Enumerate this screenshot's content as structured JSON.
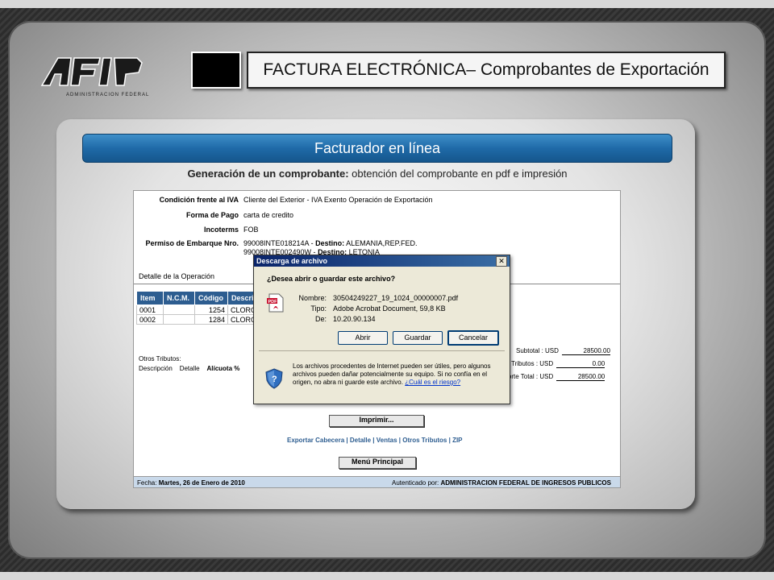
{
  "slide": {
    "logo_text": "AFIP",
    "logo_subtext": "ADMINISTRACION FEDERAL",
    "title": "FACTURA ELECTRÓNICA– Comprobantes de Exportación",
    "banner": "Facturador en línea",
    "subtitle_bold": "Generación de un comprobante:",
    "subtitle_rest": " obtención del comprobante  en pdf e impresión"
  },
  "form": {
    "fields": [
      {
        "label": "Condición frente al IVA",
        "value": "Cliente del Exterior - IVA Exento Operación de Exportación"
      },
      {
        "label": "Forma de Pago",
        "value": "carta de credito"
      },
      {
        "label": "Incoterms",
        "value": "FOB"
      },
      {
        "label": "Permiso de Embarque Nro.",
        "value": "99008INTE018214A - ",
        "dest_label": "Destino:",
        "dest": " ALEMANIA,REP.FED."
      }
    ],
    "permiso2": "99008INTE002490W - ",
    "permiso2_dest_label": "Destino:",
    "permiso2_dest": " LETONIA",
    "detalle_title": "Detalle de la Operación",
    "table": {
      "headers": [
        "Item",
        "N.C.M.",
        "Código",
        "Descrip"
      ],
      "rows": [
        [
          "0001",
          "",
          "1254",
          "CLORO"
        ],
        [
          "0002",
          "",
          "1284",
          "CLORO"
        ]
      ]
    },
    "subtotal_label": "Subtotal : USD",
    "subtotal_value": "28500.00",
    "tributos_label": "Tributos : USD",
    "tributos_value": "0.00",
    "total_label": "nporte Total : USD",
    "total_value": "28500.00",
    "otros_title": "Otros Tributos:",
    "otros_headers": [
      "Descripción",
      "Detalle",
      "Alícuota %"
    ],
    "imprimir": "Imprimir...",
    "links": [
      "Exportar Cabecera",
      "Detalle",
      "Ventas",
      "Otros Tributos",
      "ZIP"
    ],
    "link_sep": " | ",
    "menu_principal": "Menú Principal",
    "footer_fecha_label": "Fecha: ",
    "footer_fecha": "Martes, 26 de Enero de 2010",
    "footer_auth_label": "Autenticado por: ",
    "footer_auth": "ADMINISTRACION FEDERAL DE INGRESOS PUBLICOS"
  },
  "dialog": {
    "title": "Descarga de archivo",
    "close": "✕",
    "question": "¿Desea abrir o guardar este archivo?",
    "icon_text": "PDF",
    "nombre_label": "Nombre:",
    "nombre": "30504249227_19_1024_00000007.pdf",
    "tipo_label": "Tipo:",
    "tipo": "Adobe Acrobat Document, 59,8 KB",
    "de_label": "De:",
    "de": "10.20.90.134",
    "btn_abrir": "Abrir",
    "btn_guardar": "Guardar",
    "btn_cancelar": "Cancelar",
    "warning": "Los archivos procedentes de Internet pueden ser útiles, pero algunos archivos pueden dañar potencialmente su equipo. Si no confía en el origen, no abra ni guarde este archivo. ",
    "warning_link": "¿Cuál es el riesgo?"
  }
}
